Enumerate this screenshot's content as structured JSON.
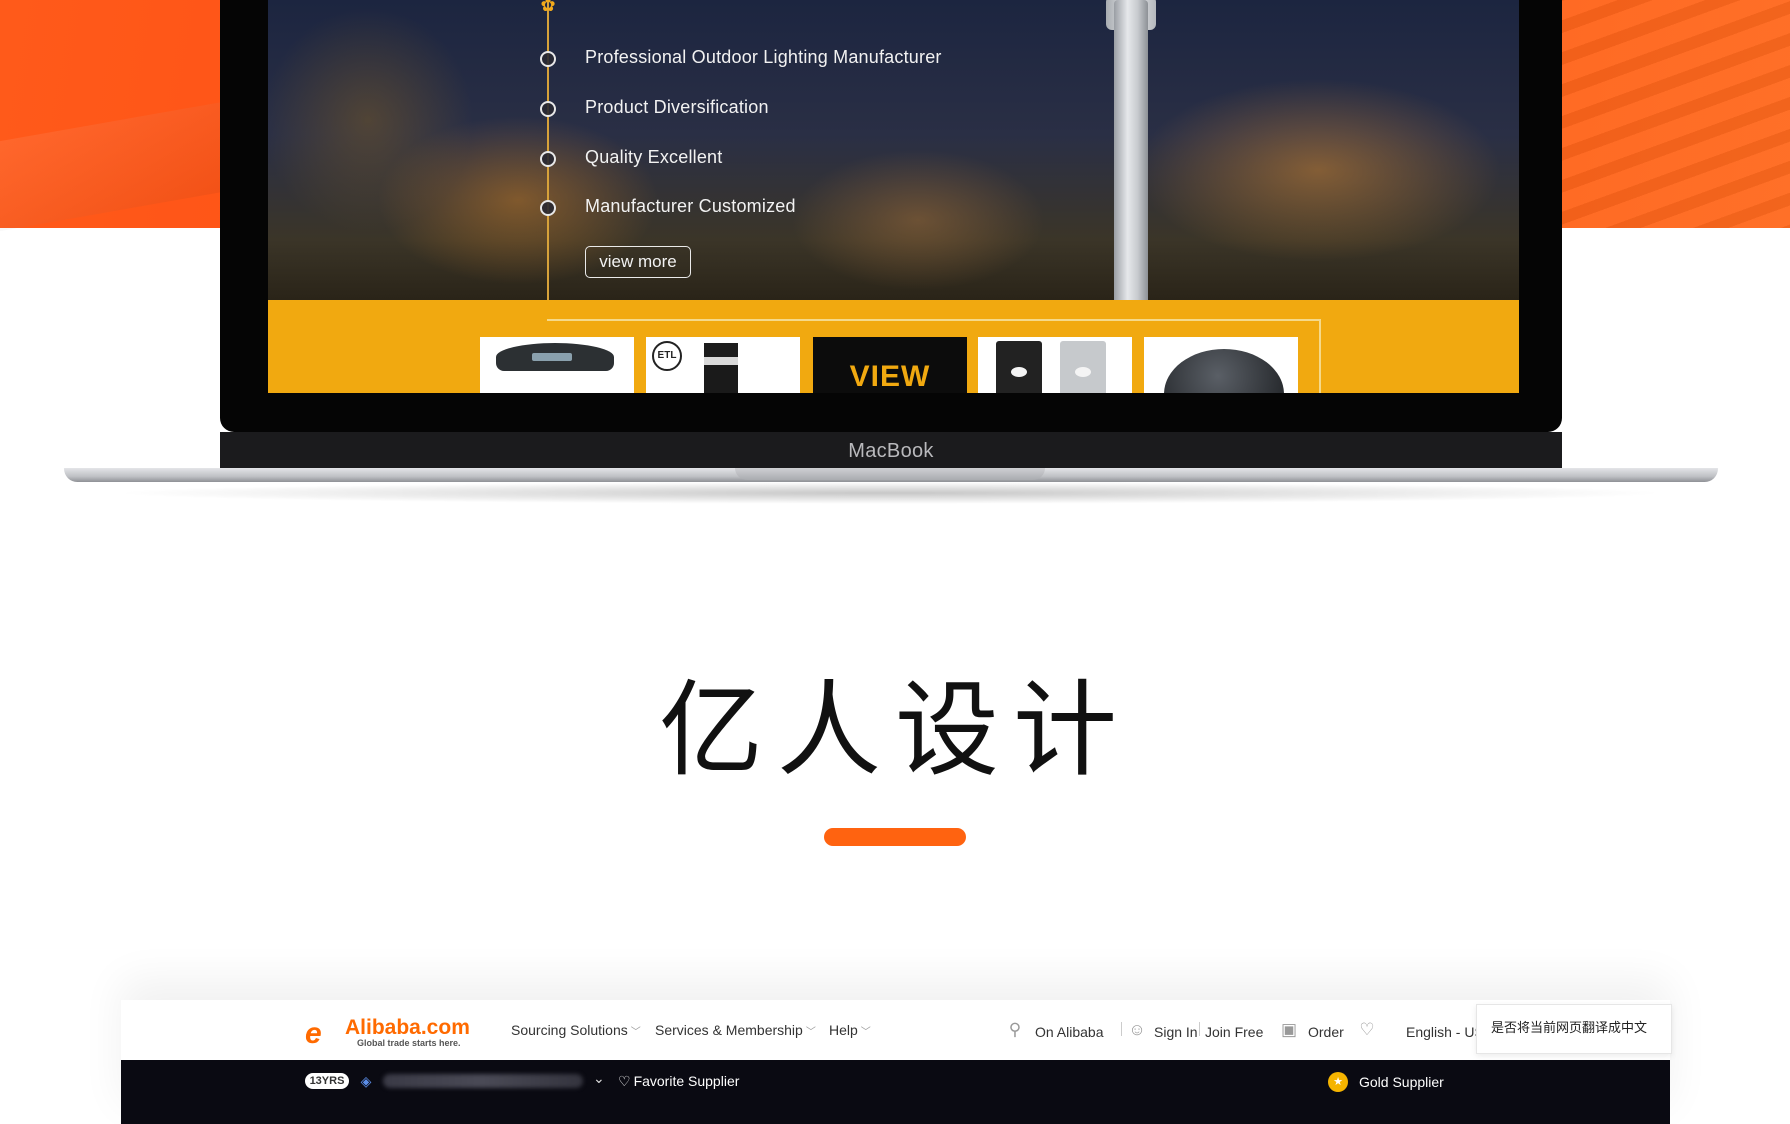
{
  "hero": {
    "features": [
      "Professional Outdoor Lighting Manufacturer",
      "Product Diversification",
      "Quality Excellent",
      "Manufacturer Customized"
    ],
    "view_more_label": "view more",
    "view_thumb_label": "VIEW",
    "etl_badge": "ETL"
  },
  "laptop": {
    "brand_label": "MacBook"
  },
  "brand": {
    "title": "亿人设计",
    "accent_color": "#ff6310"
  },
  "alibaba": {
    "logo_mark": "e",
    "logo_text": "Alibaba.com",
    "logo_tagline": "Global trade starts here.",
    "nav": [
      {
        "label": "Sourcing Solutions"
      },
      {
        "label": "Services & Membership"
      },
      {
        "label": "Help"
      }
    ],
    "search_label": "On Alibaba",
    "sign_in": "Sign In",
    "join_free": "Join Free",
    "order": "Order",
    "language": "English - US",
    "translate_prompt": "是否将当前网页翻译成中文",
    "years_badge": "13YRS",
    "favorite_label": "Favorite Supplier",
    "gold_label": "Gold Supplier",
    "brand_color": "#ff6a00"
  },
  "icons": {
    "bulb": "bulb-icon",
    "search": "search-icon",
    "user": "user-icon",
    "order": "order-icon",
    "heart": "heart-icon",
    "gold": "gold-medal-icon",
    "verified": "verified-icon"
  }
}
